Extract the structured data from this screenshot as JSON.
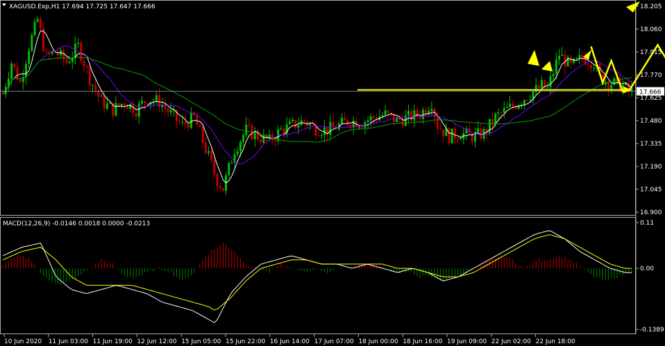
{
  "header": {
    "symbol_line": "XAGUSD.Exp,H1  17.694 17.725 17.647 17.666",
    "macd_line": "MACD(12,26,9) -0.0146 0.0018 0.0000 -0.0213"
  },
  "colors": {
    "background": "#000000",
    "frame": "#b0b0b0",
    "bull": "#00c000",
    "bear": "#c00000",
    "ma_fast": "#ffffff",
    "ma_mid": "#8000ff",
    "ma_slow": "#00a000",
    "arrows": "#ffff00",
    "price_line": "#c0c0c0",
    "hist_pos": "#c00000",
    "hist_neg": "#008000",
    "macd_main": "#ffffff",
    "macd_signal": "#ffff00"
  },
  "chart_data": [
    {
      "type": "candlestick",
      "title": "XAGUSD.Exp,H1",
      "ohlc_current": {
        "open": 17.694,
        "high": 17.725,
        "low": 17.647,
        "close": 17.666
      },
      "current_price_label": "17.666",
      "y_ticks": [
        "18.205",
        "18.060",
        "17.915",
        "17.770",
        "17.625",
        "17.480",
        "17.335",
        "17.190",
        "17.045",
        "16.900"
      ],
      "ylim": [
        16.87,
        18.25
      ],
      "x_ticks": [
        "10 Jun 2020",
        "11 Jun 03:00",
        "11 Jun 19:00",
        "12 Jun 12:00",
        "15 Jun 05:00",
        "15 Jun 22:00",
        "16 Jun 14:00",
        "17 Jun 07:00",
        "18 Jun 00:00",
        "18 Jun 16:00",
        "19 Jun 09:00",
        "22 Jun 02:00",
        "22 Jun 18:00"
      ],
      "close_path_anchors": [
        [
          0,
          17.65
        ],
        [
          3,
          17.85
        ],
        [
          6,
          17.72
        ],
        [
          9,
          17.95
        ],
        [
          12,
          18.12
        ],
        [
          15,
          17.88
        ],
        [
          18,
          17.92
        ],
        [
          22,
          17.85
        ],
        [
          26,
          17.95
        ],
        [
          30,
          17.75
        ],
        [
          34,
          17.6
        ],
        [
          38,
          17.55
        ],
        [
          42,
          17.6
        ],
        [
          46,
          17.55
        ],
        [
          50,
          17.62
        ],
        [
          54,
          17.6
        ],
        [
          58,
          17.52
        ],
        [
          62,
          17.45
        ],
        [
          66,
          17.5
        ],
        [
          70,
          17.3
        ],
        [
          74,
          17.1
        ],
        [
          76,
          17.05
        ],
        [
          80,
          17.3
        ],
        [
          84,
          17.42
        ],
        [
          88,
          17.38
        ],
        [
          92,
          17.35
        ],
        [
          96,
          17.42
        ],
        [
          100,
          17.45
        ],
        [
          104,
          17.48
        ],
        [
          108,
          17.43
        ],
        [
          112,
          17.42
        ],
        [
          116,
          17.45
        ],
        [
          120,
          17.48
        ],
        [
          124,
          17.47
        ],
        [
          128,
          17.5
        ],
        [
          132,
          17.52
        ],
        [
          136,
          17.48
        ],
        [
          140,
          17.5
        ],
        [
          144,
          17.52
        ],
        [
          148,
          17.6
        ],
        [
          150,
          17.45
        ],
        [
          154,
          17.38
        ],
        [
          158,
          17.4
        ],
        [
          162,
          17.38
        ],
        [
          166,
          17.4
        ],
        [
          170,
          17.5
        ],
        [
          174,
          17.55
        ],
        [
          178,
          17.6
        ],
        [
          182,
          17.65
        ],
        [
          186,
          17.7
        ],
        [
          188,
          17.68
        ],
        [
          192,
          17.9
        ],
        [
          196,
          17.82
        ],
        [
          200,
          17.88
        ],
        [
          204,
          17.85
        ],
        [
          206,
          17.75
        ],
        [
          210,
          17.72
        ],
        [
          214,
          17.7
        ],
        [
          216,
          17.666
        ]
      ],
      "series": [
        {
          "type": "line",
          "values_ref": "close_path_anchors",
          "smoothing": 5
        },
        {
          "type": "line",
          "values_ref": "close_path_anchors",
          "smoothing": 14
        },
        {
          "type": "line",
          "values_ref": "close_path_anchors",
          "smoothing": 40
        }
      ],
      "annotations": {
        "horizontal_level": 17.666,
        "arrow_path": [
          [
            216,
            17.666
          ],
          [
            226,
            17.96
          ],
          [
            232,
            17.78
          ],
          [
            244,
            18.25
          ]
        ],
        "zigzag": [
          [
            203,
            17.95
          ],
          [
            207,
            17.72
          ],
          [
            210,
            17.86
          ],
          [
            214,
            17.66
          ]
        ]
      }
    },
    {
      "type": "bar",
      "title": "MACD(12,26,9)",
      "y_ticks": [
        "0.11",
        "0.00",
        "-0.1389"
      ],
      "ylim": [
        -0.1389,
        0.11
      ],
      "values": {
        "main": -0.0146,
        "signal": 0.0018,
        "extra": [
          0.0,
          -0.0213
        ]
      },
      "histogram_anchors": [
        [
          0,
          0.01
        ],
        [
          6,
          0.03
        ],
        [
          10,
          0.02
        ],
        [
          14,
          -0.02
        ],
        [
          20,
          -0.04
        ],
        [
          26,
          -0.02
        ],
        [
          30,
          0.0
        ],
        [
          34,
          0.02
        ],
        [
          38,
          0.01
        ],
        [
          42,
          -0.02
        ],
        [
          46,
          -0.02
        ],
        [
          50,
          -0.01
        ],
        [
          54,
          0.0
        ],
        [
          58,
          -0.01
        ],
        [
          62,
          -0.03
        ],
        [
          66,
          -0.01
        ],
        [
          70,
          0.03
        ],
        [
          74,
          0.05
        ],
        [
          76,
          0.06
        ],
        [
          80,
          0.04
        ],
        [
          84,
          0.01
        ],
        [
          88,
          0.0
        ],
        [
          92,
          -0.01
        ],
        [
          96,
          0.01
        ],
        [
          100,
          0.0
        ],
        [
          104,
          -0.01
        ],
        [
          108,
          0.0
        ],
        [
          112,
          -0.01
        ],
        [
          116,
          0.0
        ],
        [
          120,
          0.0
        ],
        [
          124,
          0.01
        ],
        [
          128,
          0.01
        ],
        [
          132,
          0.0
        ],
        [
          136,
          -0.01
        ],
        [
          140,
          -0.01
        ],
        [
          144,
          -0.02
        ],
        [
          148,
          -0.02
        ],
        [
          152,
          -0.03
        ],
        [
          156,
          -0.02
        ],
        [
          160,
          -0.01
        ],
        [
          164,
          0.0
        ],
        [
          168,
          0.02
        ],
        [
          172,
          0.03
        ],
        [
          176,
          0.02
        ],
        [
          180,
          0.0
        ],
        [
          184,
          0.02
        ],
        [
          188,
          0.02
        ],
        [
          192,
          0.03
        ],
        [
          196,
          0.02
        ],
        [
          200,
          0.0
        ],
        [
          204,
          -0.02
        ],
        [
          208,
          -0.03
        ],
        [
          212,
          -0.02
        ],
        [
          216,
          -0.01
        ]
      ],
      "main_anchors": [
        [
          0,
          0.03
        ],
        [
          5,
          0.05
        ],
        [
          10,
          0.06
        ],
        [
          14,
          -0.02
        ],
        [
          18,
          -0.05
        ],
        [
          22,
          -0.06
        ],
        [
          26,
          -0.05
        ],
        [
          30,
          -0.04
        ],
        [
          34,
          -0.05
        ],
        [
          38,
          -0.06
        ],
        [
          42,
          -0.08
        ],
        [
          46,
          -0.09
        ],
        [
          50,
          -0.1
        ],
        [
          54,
          -0.12
        ],
        [
          56,
          -0.13
        ],
        [
          60,
          -0.06
        ],
        [
          64,
          -0.02
        ],
        [
          68,
          0.01
        ],
        [
          72,
          0.02
        ],
        [
          76,
          0.03
        ],
        [
          80,
          0.02
        ],
        [
          84,
          0.01
        ],
        [
          88,
          0.01
        ],
        [
          92,
          0.0
        ],
        [
          96,
          0.01
        ],
        [
          100,
          0.0
        ],
        [
          104,
          -0.01
        ],
        [
          108,
          0.0
        ],
        [
          112,
          -0.01
        ],
        [
          116,
          -0.03
        ],
        [
          120,
          -0.02
        ],
        [
          124,
          0.0
        ],
        [
          128,
          0.02
        ],
        [
          132,
          0.04
        ],
        [
          136,
          0.06
        ],
        [
          140,
          0.08
        ],
        [
          144,
          0.09
        ],
        [
          148,
          0.07
        ],
        [
          152,
          0.04
        ],
        [
          156,
          0.02
        ],
        [
          160,
          0.0
        ],
        [
          164,
          -0.01
        ]
      ],
      "signal_anchors": [
        [
          0,
          0.02
        ],
        [
          5,
          0.04
        ],
        [
          10,
          0.05
        ],
        [
          14,
          0.02
        ],
        [
          18,
          -0.02
        ],
        [
          22,
          -0.04
        ],
        [
          26,
          -0.04
        ],
        [
          30,
          -0.04
        ],
        [
          34,
          -0.04
        ],
        [
          38,
          -0.05
        ],
        [
          42,
          -0.06
        ],
        [
          46,
          -0.07
        ],
        [
          50,
          -0.08
        ],
        [
          54,
          -0.09
        ],
        [
          56,
          -0.1
        ],
        [
          60,
          -0.07
        ],
        [
          64,
          -0.03
        ],
        [
          68,
          0.0
        ],
        [
          72,
          0.01
        ],
        [
          76,
          0.02
        ],
        [
          80,
          0.02
        ],
        [
          84,
          0.01
        ],
        [
          88,
          0.01
        ],
        [
          92,
          0.01
        ],
        [
          96,
          0.01
        ],
        [
          100,
          0.01
        ],
        [
          104,
          0.0
        ],
        [
          108,
          0.0
        ],
        [
          112,
          -0.01
        ],
        [
          116,
          -0.02
        ],
        [
          120,
          -0.02
        ],
        [
          124,
          -0.01
        ],
        [
          128,
          0.01
        ],
        [
          132,
          0.03
        ],
        [
          136,
          0.05
        ],
        [
          140,
          0.07
        ],
        [
          144,
          0.08
        ],
        [
          148,
          0.07
        ],
        [
          152,
          0.05
        ],
        [
          156,
          0.03
        ],
        [
          160,
          0.01
        ],
        [
          164,
          0.0
        ]
      ]
    }
  ]
}
